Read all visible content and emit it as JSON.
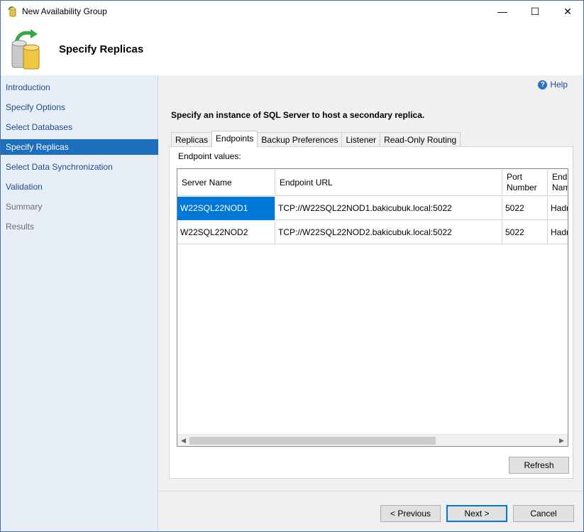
{
  "window": {
    "title": "New Availability Group",
    "controls": {
      "minimize": "—",
      "maximize": "☐",
      "close": "✕"
    }
  },
  "header": {
    "title": "Specify Replicas"
  },
  "nav": {
    "items": [
      {
        "label": "Introduction",
        "state": "normal"
      },
      {
        "label": "Specify Options",
        "state": "normal"
      },
      {
        "label": "Select Databases",
        "state": "normal"
      },
      {
        "label": "Specify Replicas",
        "state": "selected"
      },
      {
        "label": "Select Data Synchronization",
        "state": "normal"
      },
      {
        "label": "Validation",
        "state": "normal"
      },
      {
        "label": "Summary",
        "state": "disabled"
      },
      {
        "label": "Results",
        "state": "disabled"
      }
    ]
  },
  "help": {
    "label": "Help"
  },
  "instruction": "Specify an instance of SQL Server to host a secondary replica.",
  "tabs": [
    {
      "label": "Replicas"
    },
    {
      "label": "Endpoints",
      "active": true
    },
    {
      "label": "Backup Preferences"
    },
    {
      "label": "Listener"
    },
    {
      "label": "Read-Only Routing"
    }
  ],
  "endpoints": {
    "label": "Endpoint values:",
    "columns": [
      "Server Name",
      "Endpoint URL",
      "Port Number",
      "Endpoint Name"
    ],
    "rows": [
      {
        "server": "W22SQL22NOD1",
        "url": "TCP://W22SQL22NOD1.bakicubuk.local:5022",
        "port": "5022",
        "name": "Hadr_endpoint"
      },
      {
        "server": "W22SQL22NOD2",
        "url": "TCP://W22SQL22NOD2.bakicubuk.local:5022",
        "port": "5022",
        "name": "Hadr_endpoint"
      }
    ],
    "refresh_label": "Refresh"
  },
  "footer": {
    "previous_label": "< Previous",
    "next_label": "Next >",
    "cancel_label": "Cancel"
  }
}
